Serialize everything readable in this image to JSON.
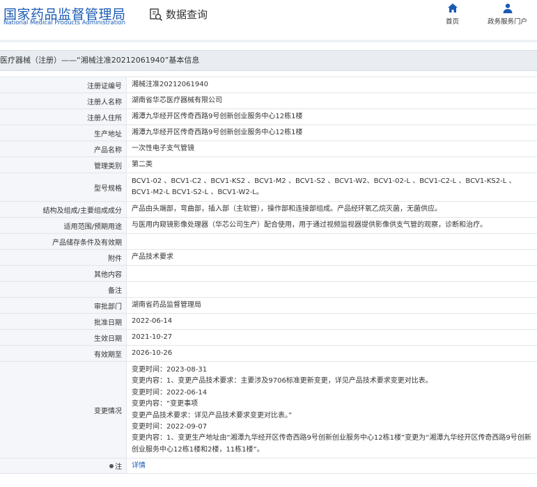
{
  "header": {
    "logo_cn": "国家药品监督管理局",
    "logo_en": "National Medical Products Administration",
    "search_title": "数据查询",
    "nav": [
      {
        "label": "首页",
        "icon": "home-icon"
      },
      {
        "label": "政务服务门户",
        "icon": "user-icon"
      }
    ]
  },
  "section_title": "医疗器械（注册）——“湘械注准20212061940”基本信息",
  "fields": [
    {
      "label": "注册证编号",
      "value": "湘械注准20212061940"
    },
    {
      "label": "注册人名称",
      "value": "湖南省华芯医疗器械有限公司"
    },
    {
      "label": "注册人住所",
      "value": "湘潭九华经开区传奇西路9号创新创业服务中心12栋1楼"
    },
    {
      "label": "生产地址",
      "value": "湘潭九华经开区传奇西路9号创新创业服务中心12栋1楼"
    },
    {
      "label": "产品名称",
      "value": "一次性电子支气管镜"
    },
    {
      "label": "管理类别",
      "value": "第二类"
    },
    {
      "label": "型号规格",
      "value": "BCV1-02 、BCV1-C2 、BCV1-KS2 、BCV1-M2 、BCV1-S2 、BCV1-W2、BCV1-02-L 、BCV1-C2-L 、BCV1-KS2-L 、BCV1-M2-L BCV1-S2-L 、BCV1-W2-L。"
    },
    {
      "label": "结构及组成/主要组成成分",
      "value": "产品由头端部，弯曲部，插入部（主软管），操作部和连接部组成。产品经环氧乙烷灭菌，无菌供应。"
    },
    {
      "label": "适用范围/预期用途",
      "value": "与医用内窥镜影像处理器（华芯公司生产）配合使用，用于通过视频监视器提供影像供支气管的观察，诊断和治疗。"
    },
    {
      "label": "产品储存条件及有效期",
      "value": ""
    },
    {
      "label": "附件",
      "value": "产品技术要求"
    },
    {
      "label": "其他内容",
      "value": ""
    },
    {
      "label": "备注",
      "value": ""
    },
    {
      "label": "审批部门",
      "value": "湖南省药品监督管理局"
    },
    {
      "label": "批准日期",
      "value": "2022-06-14"
    },
    {
      "label": "生效日期",
      "value": "2021-10-27"
    },
    {
      "label": "有效期至",
      "value": "2026-10-26"
    }
  ],
  "change_history": {
    "label": "变更情况",
    "lines": [
      "变更时间：2023-08-31",
      "变更内容：1、变更产品技术要求：主要涉及9706标准更新变更，详见产品技术要求变更对比表。",
      "变更时间：2022-06-14",
      "变更内容：“变更事项",
      "变更产品技术要求：详见产品技术要求变更对比表。”",
      "变更时间：2022-09-07",
      "变更内容：1、变更生产地址由“湘潭九华经开区传奇西路9号创新创业服务中心12栋1楼”变更为“湘潭九华经开区传奇西路9号创新创业服务中心12栋1楼和2楼，11栋1楼”。"
    ]
  },
  "note": {
    "label": "注",
    "link": "详情"
  },
  "colors": {
    "brand": "#1a5bb5",
    "label_bg": "#f4f6f9",
    "border": "#e1e6ec"
  }
}
